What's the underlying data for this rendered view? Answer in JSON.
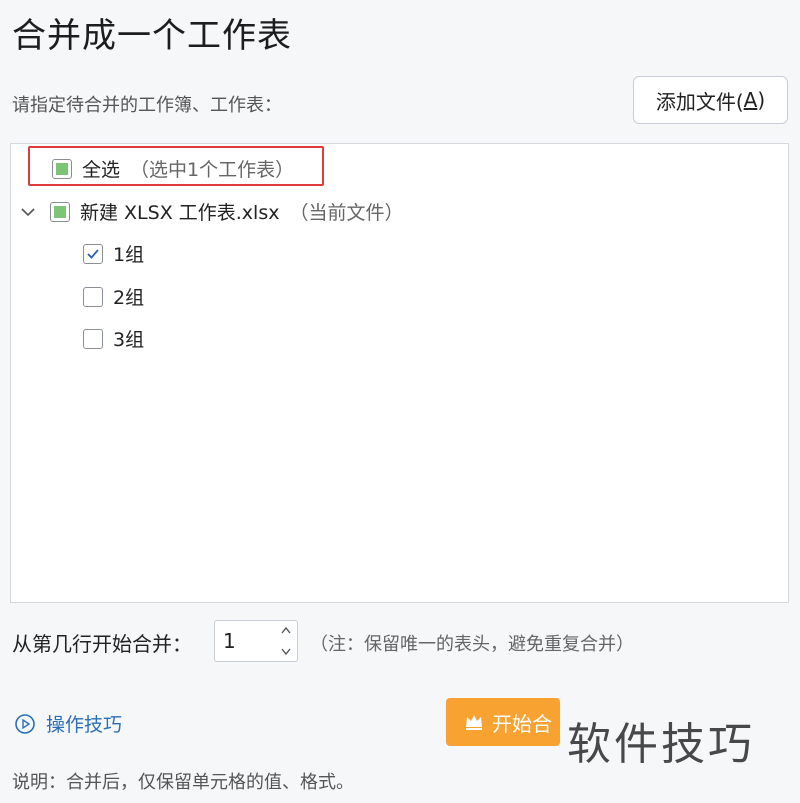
{
  "dialog": {
    "title": "合并成一个工作表",
    "instruction": "请指定待合并的工作簿、工作表：",
    "add_file_button": {
      "label": "添加文件(",
      "accel": "A",
      "close": ")"
    }
  },
  "tree": {
    "select_all": {
      "label": "全选",
      "detail": "（选中1个工作表）",
      "state": "partial"
    },
    "workbook": {
      "name": "新建 XLSX 工作表.xlsx",
      "detail": "（当前文件）",
      "state": "partial",
      "expanded": true
    },
    "sheets": [
      {
        "label": "1组",
        "checked": true
      },
      {
        "label": "2组",
        "checked": false
      },
      {
        "label": "3组",
        "checked": false
      }
    ]
  },
  "header_rows": {
    "label": "从第几行开始合并：",
    "value": "1",
    "note": "（注：保留唯一的表头，避免重复合并）"
  },
  "footer": {
    "tips_link": "操作技巧",
    "start_button": "开始合",
    "watermark": "软件技巧",
    "note": "说明：合并后，仅保留单元格的值、格式。"
  },
  "colors": {
    "accent_orange": "#f7a231",
    "partial_green": "#7cc576",
    "highlight_red": "#e03a3a",
    "link_blue": "#2d6fb5"
  },
  "icons": [
    "chevron-down-icon",
    "checkmark-icon",
    "play-circle-icon",
    "crown-icon",
    "spin-up-icon",
    "spin-down-icon"
  ]
}
